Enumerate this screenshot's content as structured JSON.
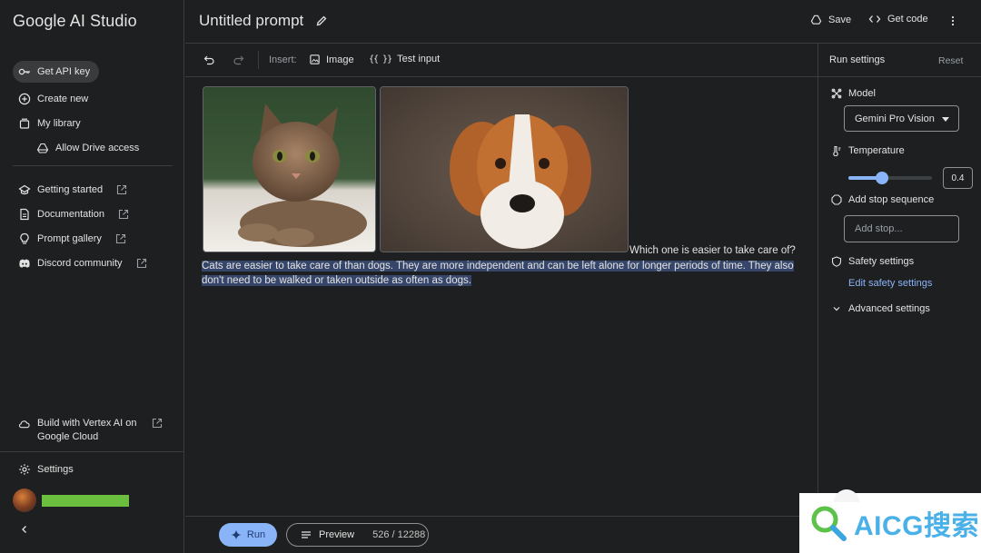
{
  "sidebar": {
    "brand": "Google AI Studio",
    "items": [
      {
        "label": "Get API key"
      },
      {
        "label": "Create new"
      },
      {
        "label": "My library"
      },
      {
        "label": "Allow Drive access"
      },
      {
        "label": "Getting started"
      },
      {
        "label": "Documentation"
      },
      {
        "label": "Prompt gallery"
      },
      {
        "label": "Discord community"
      }
    ],
    "vertex_label": "Build with Vertex AI on Google Cloud",
    "settings_label": "Settings"
  },
  "header": {
    "title": "Untitled prompt",
    "save_label": "Save",
    "get_code_label": "Get code"
  },
  "toolbar": {
    "insert_label": "Insert:",
    "image_label": "Image",
    "test_input_label": "Test input"
  },
  "prompt": {
    "question": "Which one is easier to take care of?",
    "response": "Cats are easier to take care of than dogs. They are more independent and can be left alone for longer periods of time. They also don't need to be walked or taken outside as often as dogs."
  },
  "footer": {
    "run_label": "Run",
    "preview_label": "Preview",
    "token_count": "526 / 12288"
  },
  "run_settings": {
    "title": "Run settings",
    "reset_label": "Reset",
    "model_label": "Model",
    "model_value": "Gemini Pro Vision",
    "temperature_label": "Temperature",
    "temperature_value": "0.4",
    "temperature_fraction": 0.4,
    "stop_label": "Add stop sequence",
    "stop_placeholder": "Add stop...",
    "safety_label": "Safety settings",
    "edit_safety_label": "Edit safety settings",
    "advanced_label": "Advanced settings"
  },
  "watermark": "AICG搜索",
  "colors": {
    "background": "#1e1f20",
    "accent": "#8ab4f8",
    "highlight": "#36466a",
    "user_bar": "#6cbf3e"
  }
}
